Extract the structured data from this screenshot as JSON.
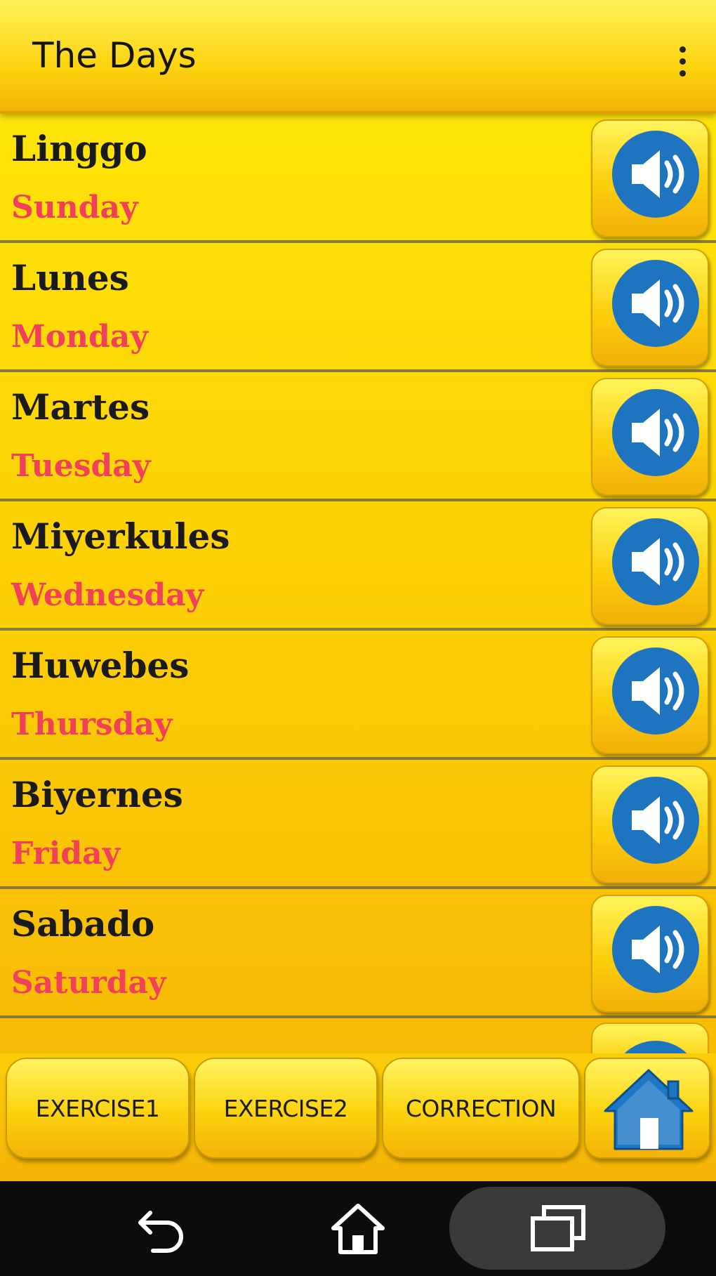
{
  "appbar": {
    "title": "The Days",
    "menu_icon": "more-vert-icon"
  },
  "rows": [
    {
      "word": "Linggo",
      "translation": "Sunday"
    },
    {
      "word": "Lunes",
      "translation": "Monday"
    },
    {
      "word": "Martes",
      "translation": "Tuesday"
    },
    {
      "word": "Miyerkules",
      "translation": "Wednesday"
    },
    {
      "word": "Huwebes",
      "translation": "Thursday"
    },
    {
      "word": "Biyernes",
      "translation": "Friday"
    },
    {
      "word": "Sabado",
      "translation": "Saturday"
    }
  ],
  "bottom": {
    "exercise1": "EXERCISE1",
    "exercise2": "EXERCISE2",
    "correction": "CORRECTION",
    "home_icon": "home-icon"
  },
  "navbar": {
    "back_icon": "back-icon",
    "home_icon": "home-outline-icon",
    "recents_icon": "recents-icon"
  },
  "colors": {
    "accent_yellow": "#fcd205",
    "translation_pink": "#f0405a",
    "speaker_blue": "#1f74c0",
    "home_blue": "#1e77c4"
  }
}
